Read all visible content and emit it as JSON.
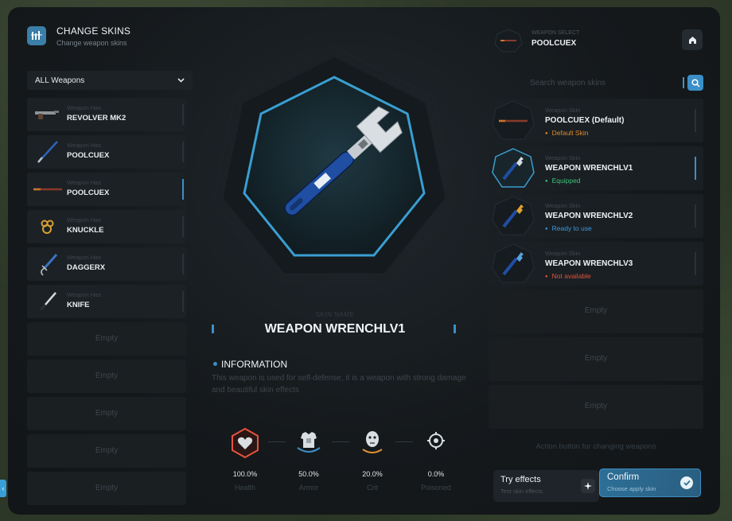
{
  "header": {
    "title": "CHANGE SKINS",
    "subtitle": "Change weapon skins"
  },
  "filter": {
    "selected": "ALL Weapons"
  },
  "weapons": [
    {
      "category": "Weapon Has",
      "name": "REVOLVER MK2",
      "icon": "revolver-icon"
    },
    {
      "category": "Weapon Has",
      "name": "POOLCUEX",
      "icon": "pool-cue-icon"
    },
    {
      "category": "Weapon Has",
      "name": "POOLCUEX",
      "icon": "pool-cue-icon",
      "active": true
    },
    {
      "category": "Weapon Has",
      "name": "KNUCKLE",
      "icon": "knuckle-icon"
    },
    {
      "category": "Weapon Has",
      "name": "DAGGERX",
      "icon": "dagger-icon"
    },
    {
      "category": "Weapon Has",
      "name": "KNIFE",
      "icon": "knife-icon"
    }
  ],
  "empty_label": "Empty",
  "preview": {
    "skin_name_label": "SKIN NAME",
    "skin_name": "WEAPON WRENCHLV1",
    "info_title": "INFORMATION",
    "info_text": "This weapon is used for self-defense, it is a weapon with strong damage and beautiful skin effects"
  },
  "stats": [
    {
      "value": "100.0%",
      "label": "Health",
      "icon": "health-icon",
      "color": "#e5533d"
    },
    {
      "value": "50.0%",
      "label": "Armor",
      "icon": "armor-icon",
      "color": "#3b8fc8"
    },
    {
      "value": "20.0%",
      "label": "Crit",
      "icon": "crit-icon",
      "color": "#e0912f"
    },
    {
      "value": "0.0%",
      "label": "Poisoned",
      "icon": "poison-icon",
      "color": "#9aa3a9"
    }
  ],
  "weapon_select": {
    "label": "WEAPON SELECT",
    "value": "POOLCUEX"
  },
  "search": {
    "placeholder": "Search weapon skins"
  },
  "skins": [
    {
      "category": "Weapon Skin",
      "name": "POOLCUEX (Default)",
      "status": "Default Skin",
      "status_color": "#e08a2e"
    },
    {
      "category": "Weapon Skin",
      "name": "WEAPON WRENCHLV1",
      "status": "Equipped",
      "status_color": "#3fc47a",
      "active": true
    },
    {
      "category": "Weapon Skin",
      "name": "WEAPON WRENCHLV2",
      "status": "Ready to use",
      "status_color": "#3b9ae0"
    },
    {
      "category": "Weapon Skin",
      "name": "WEAPON WRENCHLV3",
      "status": "Not available",
      "status_color": "#e0533d"
    }
  ],
  "actions": {
    "hint": "Action button for changing weapons",
    "try_title": "Try effects",
    "try_sub": "Test skin effects",
    "confirm_title": "Confirm",
    "confirm_sub": "Choose apply skin"
  },
  "colors": {
    "accent": "#3b8fc8",
    "panel": "#15191c"
  }
}
